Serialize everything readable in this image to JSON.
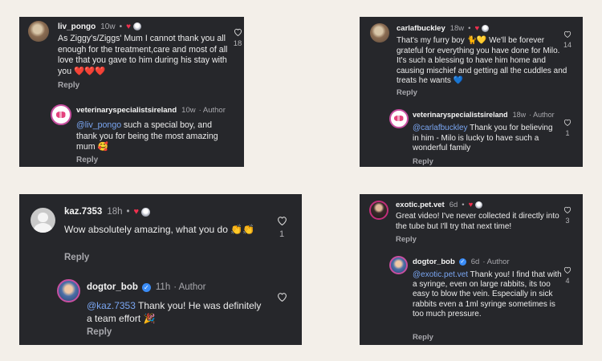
{
  "card1": {
    "comment": {
      "username": "liv_pongo",
      "time": "10w",
      "text": "As Ziggy's/Ziggs' Mum I cannot thank you all enough for the  treatment,care and most of all love that you gave to him during his stay with you ❤️❤️❤️",
      "reply": "Reply",
      "likes": "18"
    },
    "reply": {
      "username": "veterinaryspecialistsireland",
      "time": "10w",
      "author": "· Author",
      "mention": "@liv_pongo",
      "text": " such a special boy, and thank you for being the most amazing mum 🥰",
      "reply": "Reply",
      "likes": "4"
    }
  },
  "card2": {
    "comment": {
      "username": "carlafbuckley",
      "time": "18w",
      "text": "That's my furry boy 🐈💛 We'll be forever grateful for everything you have done for Milo. It's such a blessing to have him home and causing mischief and getting all the cuddles and treats he wants 💙",
      "reply": "Reply",
      "likes": "14"
    },
    "reply": {
      "username": "veterinaryspecialistsireland",
      "time": "18w",
      "author": "· Author",
      "mention": "@carlafbuckley",
      "text": " Thank you for believing in him - Milo is lucky to have such a wonderful family",
      "reply": "Reply",
      "likes": "1"
    }
  },
  "card3": {
    "comment": {
      "username": "kaz.7353",
      "time": "18h",
      "text": "Wow absolutely amazing, what you do 👏👏",
      "reply": "Reply",
      "likes": "1"
    },
    "reply": {
      "username": "dogtor_bob",
      "time": "11h",
      "author": "· Author",
      "mention": "@kaz.7353",
      "text": " Thank you! He was definitely a team effort 🎉",
      "reply": "Reply",
      "likes": ""
    }
  },
  "card4": {
    "comment": {
      "username": "exotic.pet.vet",
      "time": "6d",
      "text": "Great video! I've never collected it directly into the tube but I'll try that next time!",
      "reply": "Reply",
      "likes": "3"
    },
    "reply": {
      "username": "dogtor_bob",
      "time": "6d",
      "author": "· Author",
      "mention": "@exotic.pet.vet",
      "text": " Thank you! I find that with a syringe, even on large rabbits, its too easy to blow the vein. Especially in sick rabbits even a 1ml syringe sometimes is too much pressure.",
      "reply": "Reply",
      "likes": "4"
    }
  },
  "icons": {
    "like": "heart-outline-icon",
    "creator_liked": "heart-filled-icon",
    "verified": "verified-check-icon"
  },
  "colors": {
    "background": "#f3efe9",
    "card": "#26272b",
    "mention": "#7aa6f2",
    "heart": "#f0304e",
    "verified": "#3a8cf7"
  }
}
